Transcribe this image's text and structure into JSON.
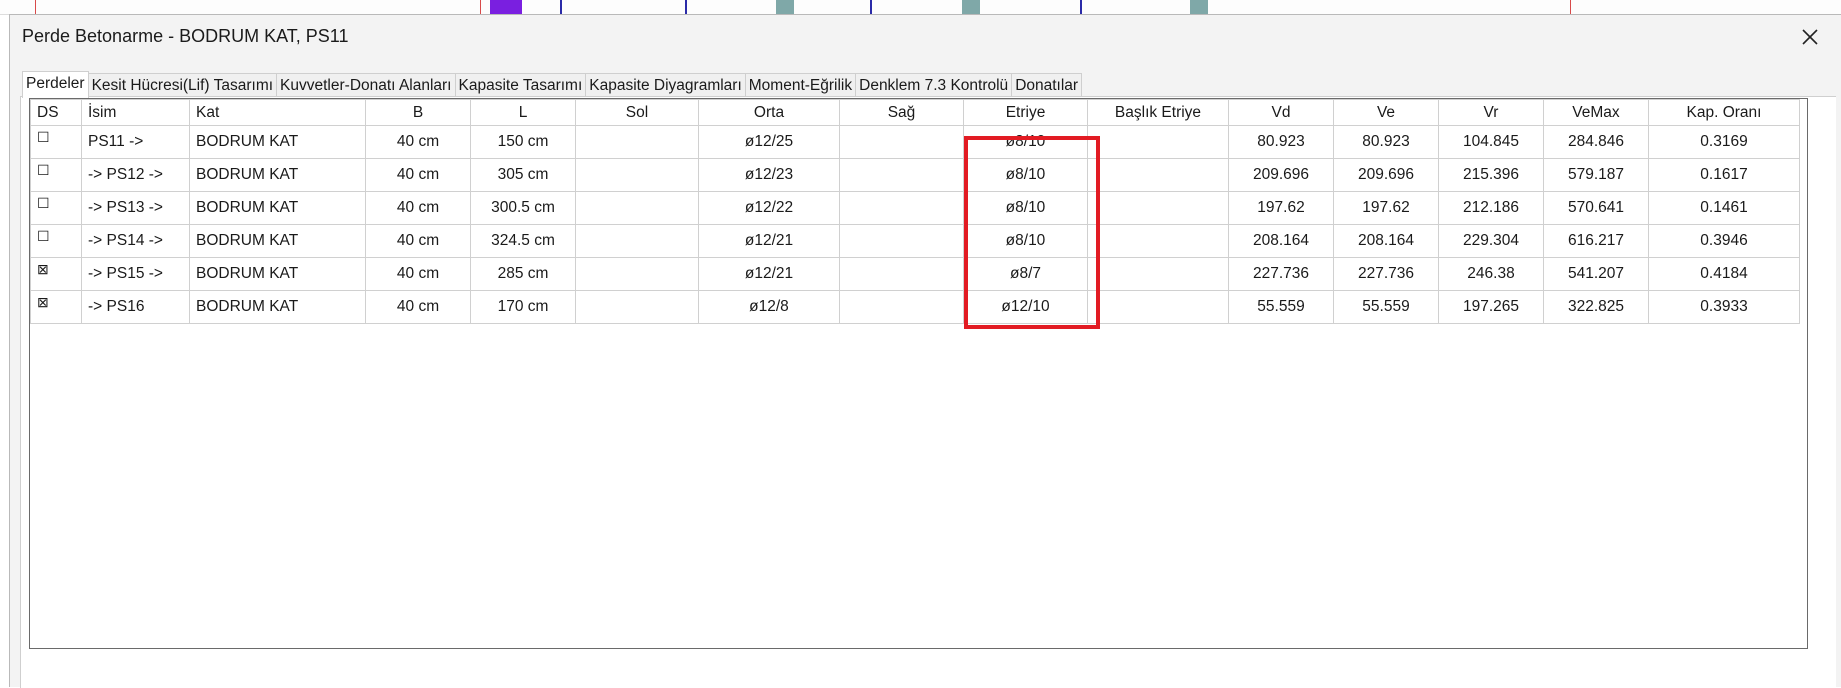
{
  "window": {
    "title": "Perde Betonarme - BODRUM KAT, PS11"
  },
  "tabs": [
    {
      "label": "Perdeler",
      "active": true
    },
    {
      "label": "Kesit Hücresi(Lif) Tasarımı",
      "active": false
    },
    {
      "label": "Kuvvetler-Donatı Alanları",
      "active": false
    },
    {
      "label": "Kapasite Tasarımı",
      "active": false
    },
    {
      "label": "Kapasite Diyagramları",
      "active": false
    },
    {
      "label": "Moment-Eğrilik",
      "active": false
    },
    {
      "label": "Denklem 7.3 Kontrolü",
      "active": false
    },
    {
      "label": "Donatılar",
      "active": false
    }
  ],
  "table": {
    "headers": [
      "DS",
      "İsim",
      "Kat",
      "B",
      "L",
      "Sol",
      "Orta",
      "Sağ",
      "Etriye",
      "Başlık Etriye",
      "Vd",
      "Ve",
      "Vr",
      "VeMax",
      "Kap. Oranı"
    ],
    "rows": [
      {
        "ds": "☐",
        "isim": "PS11 ->",
        "kat": "BODRUM KAT",
        "b": "40 cm",
        "l": "150 cm",
        "sol": "",
        "orta": "ø12/25",
        "sag": "",
        "etriye": "ø8/10",
        "baslik": "",
        "vd": "80.923",
        "ve": "80.923",
        "vr": "104.845",
        "vemax": "284.846",
        "kap": "0.3169"
      },
      {
        "ds": "☐",
        "isim": "-> PS12 ->",
        "kat": "BODRUM KAT",
        "b": "40 cm",
        "l": "305 cm",
        "sol": "",
        "orta": "ø12/23",
        "sag": "",
        "etriye": "ø8/10",
        "baslik": "",
        "vd": "209.696",
        "ve": "209.696",
        "vr": "215.396",
        "vemax": "579.187",
        "kap": "0.1617"
      },
      {
        "ds": "☐",
        "isim": "-> PS13 ->",
        "kat": "BODRUM KAT",
        "b": "40 cm",
        "l": "300.5 cm",
        "sol": "",
        "orta": "ø12/22",
        "sag": "",
        "etriye": "ø8/10",
        "baslik": "",
        "vd": "197.62",
        "ve": "197.62",
        "vr": "212.186",
        "vemax": "570.641",
        "kap": "0.1461"
      },
      {
        "ds": "☐",
        "isim": "-> PS14 ->",
        "kat": "BODRUM KAT",
        "b": "40 cm",
        "l": "324.5 cm",
        "sol": "",
        "orta": "ø12/21",
        "sag": "",
        "etriye": "ø8/10",
        "baslik": "",
        "vd": "208.164",
        "ve": "208.164",
        "vr": "229.304",
        "vemax": "616.217",
        "kap": "0.3946"
      },
      {
        "ds": "⊠",
        "isim": "-> PS15 ->",
        "kat": "BODRUM KAT",
        "b": "40 cm",
        "l": "285 cm",
        "sol": "",
        "orta": "ø12/21",
        "sag": "",
        "etriye": "ø8/7",
        "baslik": "",
        "vd": "227.736",
        "ve": "227.736",
        "vr": "246.38",
        "vemax": "541.207",
        "kap": "0.4184"
      },
      {
        "ds": "⊠",
        "isim": "-> PS16",
        "kat": "BODRUM KAT",
        "b": "40 cm",
        "l": "170 cm",
        "sol": "",
        "orta": "ø12/8",
        "sag": "",
        "etriye": "ø12/10",
        "baslik": "",
        "vd": "55.559",
        "ve": "55.559",
        "vr": "197.265",
        "vemax": "322.825",
        "kap": "0.3933"
      }
    ]
  },
  "colors": {
    "highlight": "#e21b23",
    "window_bg": "#f3f3f3",
    "grid_border": "#6a6a6a"
  },
  "icons": {
    "close": "close-icon",
    "checkbox_empty": "checkbox-unchecked-icon",
    "checkbox_x": "checkbox-crossed-icon"
  }
}
